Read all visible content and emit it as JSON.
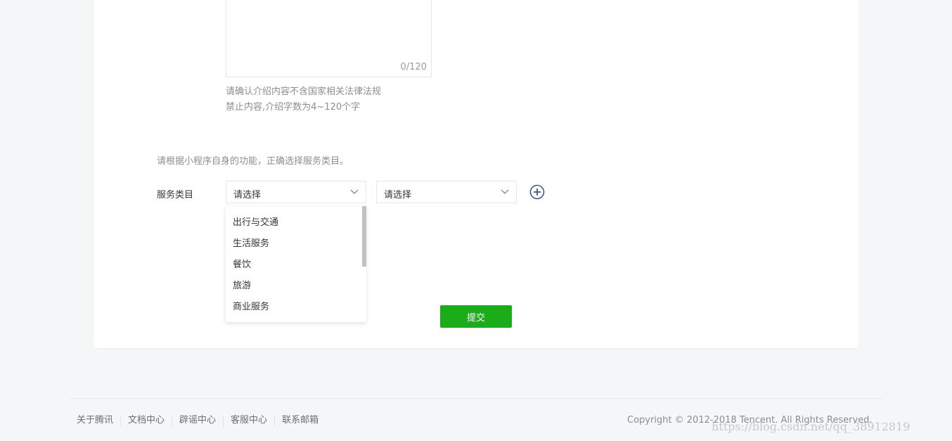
{
  "intro": {
    "counter": "0/120",
    "hint_line1": "请确认介绍内容不含国家相关法律法规",
    "hint_line2": "禁止内容,介绍字数为4~120个字"
  },
  "service": {
    "tip": "请根据小程序自身的功能，正确选择服务类目。",
    "label": "服务类目",
    "select1_value": "请选择",
    "select2_value": "请选择",
    "dropdown_options": [
      "出行与交通",
      "生活服务",
      "餐饮",
      "旅游",
      "商业服务"
    ]
  },
  "actions": {
    "submit_label": "提交"
  },
  "footer": {
    "links": [
      "关于腾讯",
      "文档中心",
      "辟谣中心",
      "客服中心",
      "联系邮箱"
    ],
    "copyright": "Copyright © 2012-2018 Tencent. All Rights Reserved.",
    "watermark": "https://blog.csdn.net/qq_38912819"
  },
  "colors": {
    "primary_green": "#1aad19",
    "add_icon": "#3c5a96"
  }
}
